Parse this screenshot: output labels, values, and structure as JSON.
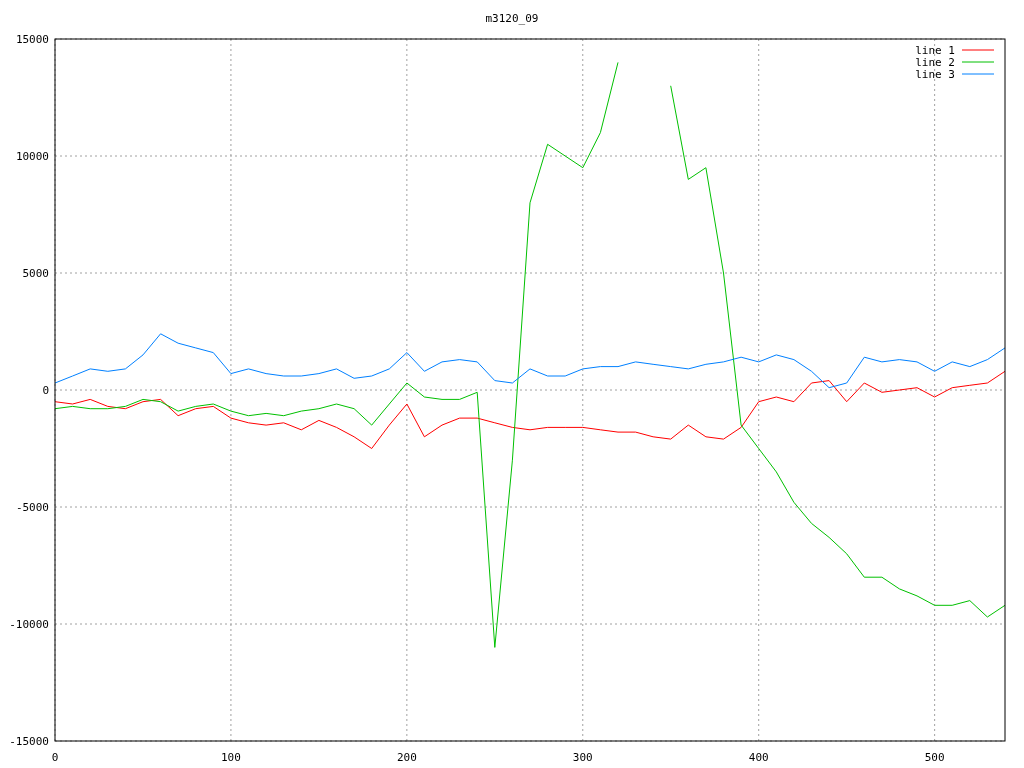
{
  "chart_data": {
    "type": "line",
    "title": "m3120_09",
    "x": [
      0,
      10,
      20,
      30,
      40,
      50,
      60,
      70,
      80,
      90,
      100,
      110,
      120,
      130,
      140,
      150,
      160,
      170,
      180,
      190,
      200,
      210,
      220,
      230,
      240,
      250,
      260,
      270,
      280,
      290,
      300,
      310,
      320,
      330,
      340,
      350,
      360,
      370,
      380,
      390,
      400,
      410,
      420,
      430,
      440,
      450,
      460,
      470,
      480,
      490,
      500,
      510,
      520,
      530,
      540
    ],
    "series": [
      {
        "name": "line 1",
        "color": "#ff0000",
        "values": [
          -500,
          -600,
          -400,
          -700,
          -800,
          -500,
          -400,
          -1100,
          -800,
          -700,
          -1200,
          -1400,
          -1500,
          -1400,
          -1700,
          -1300,
          -1600,
          -2000,
          -2500,
          -1500,
          -600,
          -2000,
          -1500,
          -1200,
          -1200,
          -1400,
          -1600,
          -1700,
          -1600,
          -1600,
          -1600,
          -1700,
          -1800,
          -1800,
          -2000,
          -2100,
          -1500,
          -2000,
          -2100,
          -1600,
          -500,
          -300,
          -500,
          300,
          400,
          -500,
          300,
          -100,
          0,
          100,
          -300,
          100,
          200,
          300,
          800
        ]
      },
      {
        "name": "line 2",
        "color": "#00c000",
        "values": [
          -800,
          -700,
          -800,
          -800,
          -700,
          -400,
          -500,
          -900,
          -700,
          -600,
          -900,
          -1100,
          -1000,
          -1100,
          -900,
          -800,
          -600,
          -800,
          -1500,
          -600,
          300,
          -300,
          -400,
          -400,
          -100,
          -11000,
          -3000,
          8000,
          10500,
          10000,
          9500,
          11000,
          14000,
          null,
          null,
          13000,
          9000,
          9500,
          5000,
          -1500,
          -2500,
          -3500,
          -4800,
          -5700,
          -6300,
          -7000,
          -8000,
          -8000,
          -8500,
          -8800,
          -9200,
          -9200,
          -9000,
          -9700,
          -9200
        ]
      },
      {
        "name": "line 3",
        "color": "#0080ff",
        "values": [
          300,
          600,
          900,
          800,
          900,
          1500,
          2400,
          2000,
          1800,
          1600,
          700,
          900,
          700,
          600,
          600,
          700,
          900,
          500,
          600,
          900,
          1600,
          800,
          1200,
          1300,
          1200,
          400,
          300,
          900,
          600,
          600,
          900,
          1000,
          1000,
          1200,
          1100,
          1000,
          900,
          1100,
          1200,
          1400,
          1200,
          1500,
          1300,
          800,
          100,
          300,
          1400,
          1200,
          1300,
          1200,
          800,
          1200,
          1000,
          1300,
          1800
        ]
      }
    ],
    "xlim": [
      0,
      540
    ],
    "ylim": [
      -15000,
      15000
    ],
    "xticks": [
      0,
      100,
      200,
      300,
      400,
      500
    ],
    "yticks": [
      -15000,
      -10000,
      -5000,
      0,
      5000,
      10000,
      15000
    ],
    "grid": true,
    "legend": true
  }
}
